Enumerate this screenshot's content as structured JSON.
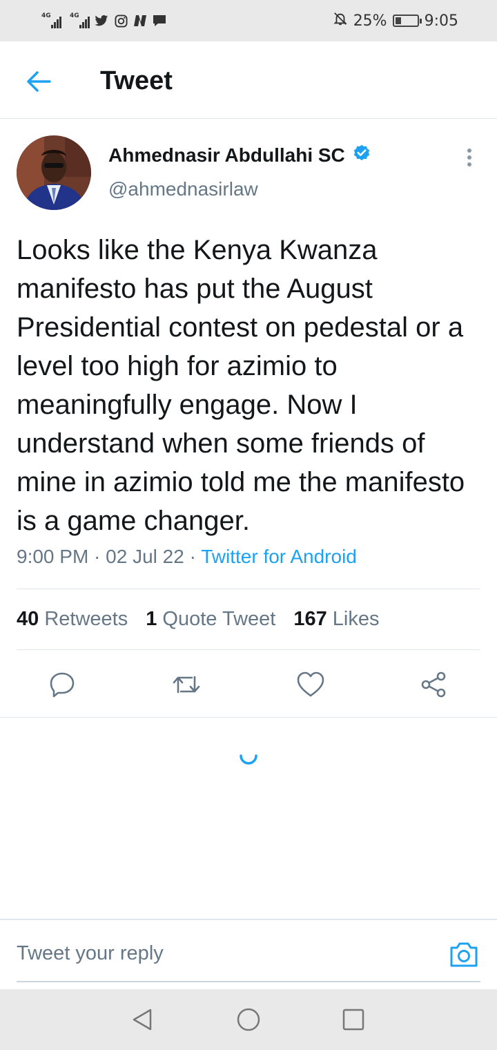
{
  "status_bar": {
    "network_1": "4G",
    "network_2": "4G",
    "battery_percent": "25%",
    "battery_level": 0.25,
    "time": "9:05",
    "notification_icons": [
      "twitter-icon",
      "instagram-icon",
      "nation-icon",
      "message-icon"
    ]
  },
  "header": {
    "title": "Tweet"
  },
  "tweet": {
    "author_name": "Ahmednasir Abdullahi SC",
    "verified": true,
    "handle": "@ahmednasirlaw",
    "text": "Looks like the Kenya Kwanza manifesto has put the August Presidential contest on pedestal or a level too high for azimio to meaningfully engage. Now I understand when some friends of mine in azimio told me the manifesto is a game changer.",
    "time": "9:00 PM",
    "date": "02 Jul 22",
    "separator": " · ",
    "source": "Twitter for Android"
  },
  "stats": {
    "retweets_count": "40",
    "retweets_label": "Retweets",
    "quotes_count": "1",
    "quotes_label": "Quote Tweet",
    "likes_count": "167",
    "likes_label": "Likes"
  },
  "reply": {
    "placeholder": "Tweet your reply"
  },
  "colors": {
    "accent": "#1da1f2",
    "text_primary": "#14171a",
    "text_secondary": "#657786",
    "divider": "#e1e8ed",
    "system_bar": "#e9e9e9"
  }
}
